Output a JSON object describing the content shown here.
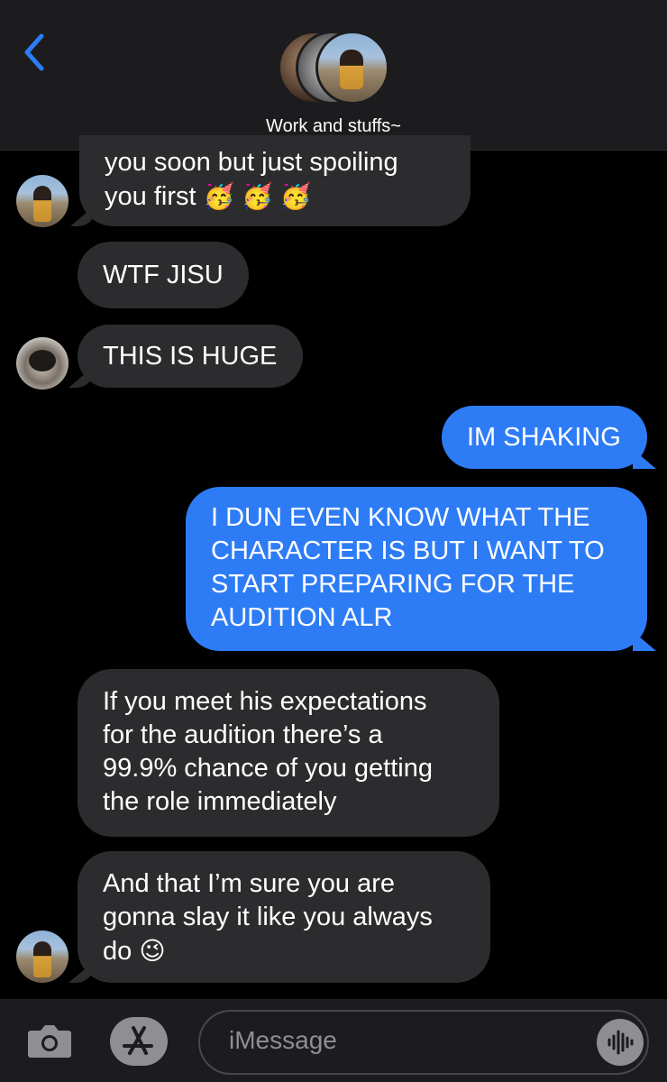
{
  "header": {
    "title": "Work and stuffs~"
  },
  "messages": [
    {
      "line1": "you soon but just spoiling",
      "line2": "you first",
      "emoji": "🥳 🥳 🥳"
    },
    {
      "text": "WTF JISU"
    },
    {
      "text": "THIS IS HUGE"
    },
    {
      "text": "IM SHAKING"
    },
    {
      "lines": [
        "I DUN EVEN KNOW WHAT THE",
        "CHARACTER IS BUT I WANT TO",
        "START PREPARING FOR THE",
        "AUDITION ALR"
      ]
    },
    {
      "lines": [
        "If you meet his expectations",
        "for the audition there’s a",
        "99.9% chance of you getting",
        "the role immediately"
      ]
    },
    {
      "lines": [
        "And that I’m sure you are",
        "gonna slay it like you always"
      ],
      "last": "do",
      "emoji": "😉"
    }
  ],
  "composer": {
    "placeholder": "iMessage"
  },
  "colors": {
    "incoming": "#2c2c2e",
    "outgoing": "#2d7cf6",
    "background": "#000000"
  },
  "icons": [
    "back-chevron-icon",
    "camera-icon",
    "app-store-icon",
    "audio-waveform-icon"
  ]
}
